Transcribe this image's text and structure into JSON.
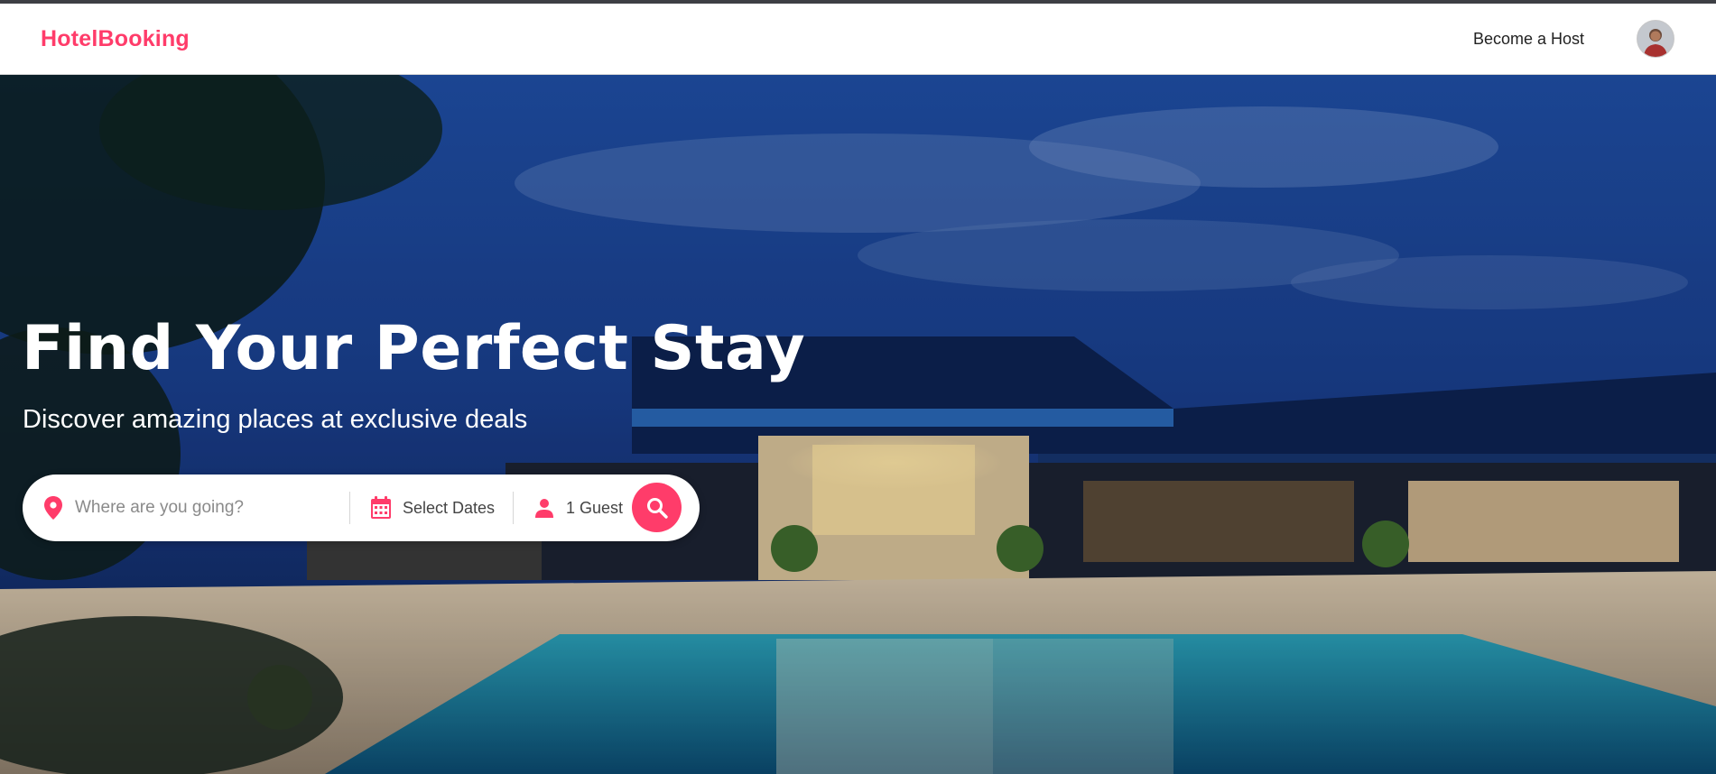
{
  "brand": {
    "name": "HotelBooking",
    "color": "#ff3c6a"
  },
  "nav": {
    "become_host": "Become a Host",
    "avatar_icon": "user-avatar"
  },
  "hero": {
    "title": "Find Your Perfect Stay",
    "subtitle": "Discover amazing places at exclusive deals",
    "background": "hotel-pool-night-photo"
  },
  "search": {
    "where_placeholder": "Where are you going?",
    "where_value": "",
    "dates_label": "Select Dates",
    "guests_label": "1 Guest",
    "icons": {
      "where": "map-pin-icon",
      "dates": "calendar-icon",
      "guests": "person-icon",
      "submit": "search-icon"
    },
    "accent": "#ff3c6a"
  }
}
